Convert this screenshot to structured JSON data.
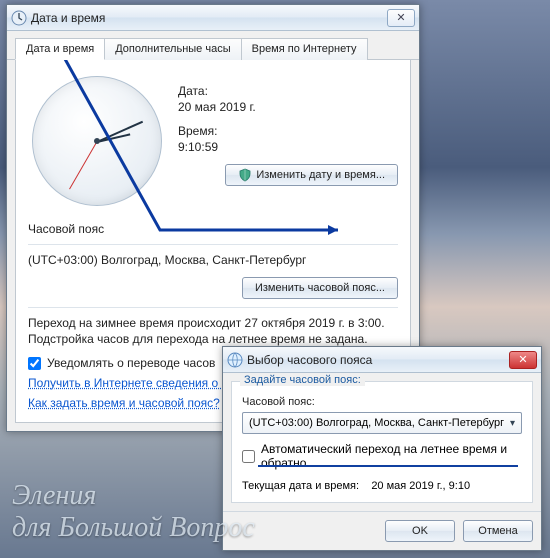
{
  "win1": {
    "title": "Дата и время",
    "tabs": [
      "Дата и время",
      "Дополнительные часы",
      "Время по Интернету"
    ],
    "date_label": "Дата:",
    "date_value": "20 мая 2019 г.",
    "time_label": "Время:",
    "time_value": "9:10:59",
    "btn_change_datetime": "Изменить дату и время...",
    "tz_heading": "Часовой пояс",
    "tz_value": "(UTC+03:00) Волгоград, Москва, Санкт-Петербург",
    "btn_change_tz": "Изменить часовой пояс...",
    "dst_line1": "Переход на зимнее время происходит 27 октября 2019 г. в 3:00.",
    "dst_line2": "Подстройка часов для перехода на летнее время не задана.",
    "notify_label": "Уведомлять о переводе часов",
    "notify_checked": true,
    "link1": "Получить в Интернете сведения о часовом поясе",
    "link2": "Как задать время и часовой пояс?",
    "close_glyph": "✕"
  },
  "win2": {
    "title": "Выбор часового пояса",
    "legend": "Задайте часовой пояс:",
    "tz_label": "Часовой пояс:",
    "tz_selected": "(UTC+03:00) Волгоград, Москва, Санкт-Петербург",
    "auto_dst_label": "Автоматический переход на летнее время и обратно",
    "auto_dst_checked": false,
    "current_label": "Текущая дата и время:",
    "current_value": "20 мая 2019 г., 9:10",
    "btn_ok": "OK",
    "btn_cancel": "Отмена",
    "close_glyph": "✕"
  },
  "watermark": {
    "line1": "Эления",
    "line2": "для Большой Вопрос"
  }
}
